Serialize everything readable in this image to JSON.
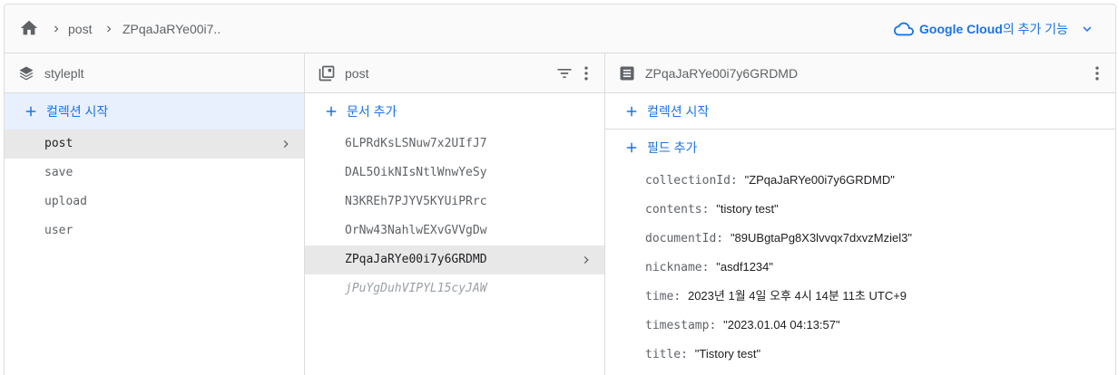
{
  "breadcrumb": {
    "items": [
      "post",
      "ZPqaJaRYe00i7.."
    ]
  },
  "gcloud": {
    "brand": "Google Cloud",
    "suffix": "의 추가 기능"
  },
  "col1": {
    "title": "styleplt",
    "add_label": "컬렉션 시작",
    "items": [
      "post",
      "save",
      "upload",
      "user"
    ]
  },
  "col2": {
    "title": "post",
    "add_label": "문서 추가",
    "items": [
      "6LPRdKsLSNuw7x2UIfJ7",
      "DAL5OikNIsNtlWnwYeSy",
      "N3KREh7PJYV5KYUiPRrc",
      "OrNw43NahlwEXvGVVgDw",
      "ZPqaJaRYe00i7y6GRDMD",
      "jPuYgDuhVIPYL15cyJAW"
    ]
  },
  "col3": {
    "title": "ZPqaJaRYe00i7y6GRDMD",
    "add_collection_label": "컬렉션 시작",
    "add_field_label": "필드 추가",
    "fields": [
      {
        "key": "collectionId",
        "value": "\"ZPqaJaRYe00i7y6GRDMD\""
      },
      {
        "key": "contents",
        "value": "\"tistory test\""
      },
      {
        "key": "documentId",
        "value": "\"89UBgtaPg8X3lvvqx7dxvzMziel3\""
      },
      {
        "key": "nickname",
        "value": "\"asdf1234\""
      },
      {
        "key": "time",
        "value": "2023년 1월 4일 오후 4시 14분 11초 UTC+9"
      },
      {
        "key": "timestamp",
        "value": "\"2023.01.04 04:13:57\""
      },
      {
        "key": "title",
        "value": "\"Tistory test\""
      }
    ]
  },
  "colors": {
    "accent": "#1a73e8",
    "selected_bg": "#e8e8e8",
    "active_bg": "#e8f0fe",
    "border": "#dadce0"
  }
}
